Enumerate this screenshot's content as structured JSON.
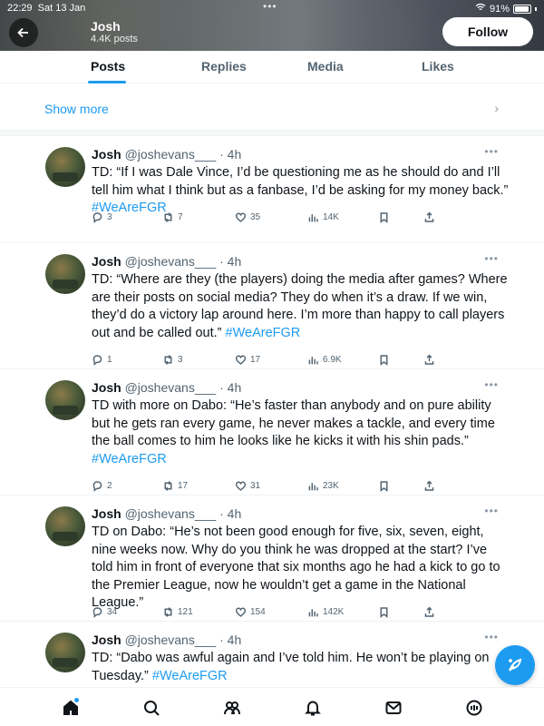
{
  "status_bar": {
    "time": "22:29",
    "date": "Sat 13 Jan",
    "dots": "•••",
    "battery": "91%"
  },
  "header": {
    "name": "Josh",
    "posts": "4.4K posts",
    "follow_label": "Follow"
  },
  "tabs": [
    {
      "label": "Posts",
      "active": true
    },
    {
      "label": "Replies",
      "active": false
    },
    {
      "label": "Media",
      "active": false
    },
    {
      "label": "Likes",
      "active": false
    }
  ],
  "show_more": {
    "label": "Show more",
    "chevron": "›"
  },
  "tweets": [
    {
      "name": "Josh",
      "handle": "@joshevans___",
      "time": "4h",
      "text": "TD: “If I was Dale Vince, I’d be questioning me as he should do and I’ll tell him what I think but as a fanbase, I’d be asking for my money back.”",
      "hashtag": "#WeAreFGR",
      "hashtag_inline": false,
      "replies": "3",
      "reposts": "7",
      "likes": "35",
      "views": "14K"
    },
    {
      "name": "Josh",
      "handle": "@joshevans___",
      "time": "4h",
      "text": "TD: “Where are they (the players) doing the media after games? Where are their posts on social media? They do when it’s a draw. If we win, they’d do a victory lap around here. I’m more than happy to call players out and be called out.”",
      "hashtag": "#WeAreFGR",
      "hashtag_inline": true,
      "replies": "1",
      "reposts": "3",
      "likes": "17",
      "views": "6.9K"
    },
    {
      "name": "Josh",
      "handle": "@joshevans___",
      "time": "4h",
      "text": "TD with more on Dabo: “He’s faster than anybody and on pure ability but he gets ran every game, he never makes a tackle, and every time the ball comes to him he looks like he kicks it with his shin pads.”",
      "hashtag": "#WeAreFGR",
      "hashtag_inline": false,
      "replies": "2",
      "reposts": "17",
      "likes": "31",
      "views": "23K"
    },
    {
      "name": "Josh",
      "handle": "@joshevans___",
      "time": "4h",
      "text": "TD on Dabo: “He’s not been good enough for five, six, seven, eight, nine weeks now. Why do you think he was dropped at the start? I’ve told him in front of everyone that six months ago he had a kick to go to the Premier League, now he wouldn’t get a game in the National League.”",
      "hashtag": "",
      "hashtag_inline": false,
      "replies": "34",
      "reposts": "121",
      "likes": "154",
      "views": "142K"
    },
    {
      "name": "Josh",
      "handle": "@joshevans___",
      "time": "4h",
      "text": "TD: “Dabo was awful again and I’ve told him. He won’t be playing on Tuesday.”",
      "hashtag": "#WeAreFGR",
      "hashtag_inline": true,
      "replies": "",
      "reposts": "",
      "likes": "",
      "views": ""
    }
  ],
  "bottom_nav": [
    {
      "icon": "home-icon"
    },
    {
      "icon": "search-icon"
    },
    {
      "icon": "communities-icon"
    },
    {
      "icon": "notifications-icon"
    },
    {
      "icon": "messages-icon"
    },
    {
      "icon": "grok-icon"
    }
  ],
  "colors": {
    "accent": "#1d9bf0",
    "text": "#0f1419",
    "secondary": "#536471"
  }
}
